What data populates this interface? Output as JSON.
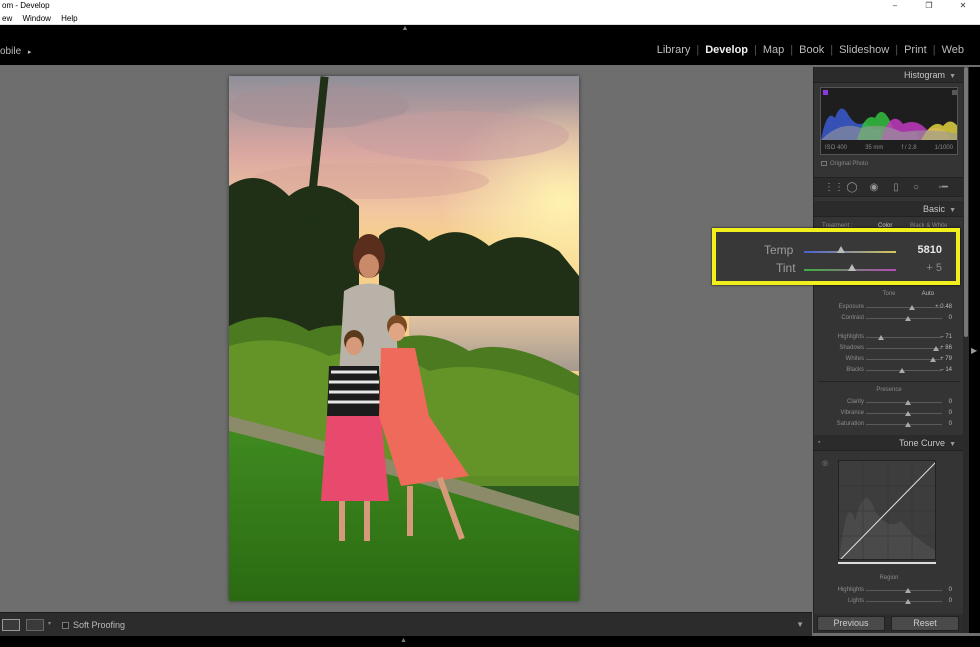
{
  "window": {
    "title": "om - Develop",
    "controls": [
      "–",
      "❐",
      "✕"
    ]
  },
  "menu": [
    "ew",
    "Window",
    "Help"
  ],
  "identity": {
    "label": "obile",
    "arrow": "▸"
  },
  "modules": [
    {
      "label": "Library",
      "active": false
    },
    {
      "label": "Develop",
      "active": true
    },
    {
      "label": "Map",
      "active": false
    },
    {
      "label": "Book",
      "active": false
    },
    {
      "label": "Slideshow",
      "active": false
    },
    {
      "label": "Print",
      "active": false
    },
    {
      "label": "Web",
      "active": false
    }
  ],
  "histogram": {
    "title": "Histogram",
    "iso": "ISO 400",
    "focal": "35 mm",
    "aperture": "f / 2.8",
    "shutter": "1/1000",
    "original_photo": "Original Photo"
  },
  "basic": {
    "title": "Basic",
    "treatment_label": "Treatment :",
    "treatment_color": "Color",
    "treatment_bw": "Black & White",
    "tone_label": "Tone",
    "auto_label": "Auto",
    "presence_label": "Presence",
    "sliders": [
      {
        "label": "Exposure",
        "value": "+ 0.48",
        "pos": 0.6
      },
      {
        "label": "Contrast",
        "value": "0",
        "pos": 0.55
      },
      {
        "label": "Highlights",
        "value": "– 71",
        "pos": 0.2
      },
      {
        "label": "Shadows",
        "value": "+ 86",
        "pos": 0.92
      },
      {
        "label": "Whites",
        "value": "+ 79",
        "pos": 0.88
      },
      {
        "label": "Blacks",
        "value": "– 14",
        "pos": 0.48
      },
      {
        "label": "Clarity",
        "value": "0",
        "pos": 0.55
      },
      {
        "label": "Vibrance",
        "value": "0",
        "pos": 0.55
      },
      {
        "label": "Saturation",
        "value": "0",
        "pos": 0.55
      }
    ]
  },
  "zoom": {
    "temp_label": "Temp",
    "temp_value": "5810",
    "temp_pos": 0.4,
    "tint_label": "Tint",
    "tint_value": "+ 5",
    "tint_pos": 0.52
  },
  "tone_curve": {
    "title": "Tone Curve",
    "region_label": "Region",
    "sliders": [
      {
        "label": "Highlights",
        "value": "0",
        "pos": 0.55
      },
      {
        "label": "Lights",
        "value": "0",
        "pos": 0.55
      }
    ]
  },
  "toolbar": {
    "soft_proofing": "Soft Proofing"
  },
  "buttons": {
    "previous": "Previous",
    "reset": "Reset"
  }
}
